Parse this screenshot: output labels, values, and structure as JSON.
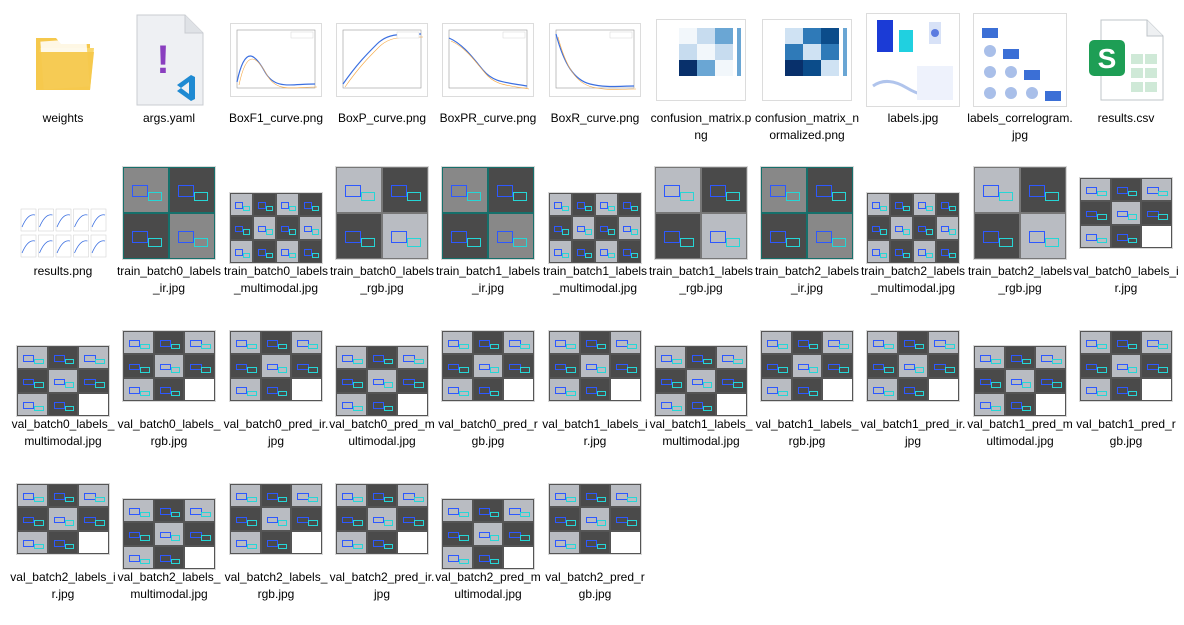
{
  "files": [
    {
      "name": "weights",
      "type": "folder"
    },
    {
      "name": "args.yaml",
      "type": "yaml"
    },
    {
      "name": "BoxF1_curve.png",
      "type": "curve"
    },
    {
      "name": "BoxP_curve.png",
      "type": "curve"
    },
    {
      "name": "BoxPR_curve.png",
      "type": "curve"
    },
    {
      "name": "BoxR_curve.png",
      "type": "curve"
    },
    {
      "name": "confusion_matrix.png",
      "type": "matrix"
    },
    {
      "name": "confusion_matrix_normalized.png",
      "type": "matrix"
    },
    {
      "name": "labels.jpg",
      "type": "labels"
    },
    {
      "name": "labels_correlogram.jpg",
      "type": "correlogram"
    },
    {
      "name": "results.csv",
      "type": "csv"
    },
    {
      "name": "results.png",
      "type": "results"
    },
    {
      "name": "train_batch0_labels_ir.jpg",
      "type": "train-ir"
    },
    {
      "name": "train_batch0_labels_multimodal.jpg",
      "type": "multimodal"
    },
    {
      "name": "train_batch0_labels_rgb.jpg",
      "type": "train-rgb"
    },
    {
      "name": "train_batch1_labels_ir.jpg",
      "type": "train-ir"
    },
    {
      "name": "train_batch1_labels_multimodal.jpg",
      "type": "multimodal"
    },
    {
      "name": "train_batch1_labels_rgb.jpg",
      "type": "train-rgb"
    },
    {
      "name": "train_batch2_labels_ir.jpg",
      "type": "train-ir"
    },
    {
      "name": "train_batch2_labels_multimodal.jpg",
      "type": "multimodal"
    },
    {
      "name": "train_batch2_labels_rgb.jpg",
      "type": "train-rgb"
    },
    {
      "name": "val_batch0_labels_ir.jpg",
      "type": "val"
    },
    {
      "name": "val_batch0_labels_multimodal.jpg",
      "type": "val-multi"
    },
    {
      "name": "val_batch0_labels_rgb.jpg",
      "type": "val"
    },
    {
      "name": "val_batch0_pred_ir.jpg",
      "type": "val"
    },
    {
      "name": "val_batch0_pred_multimodal.jpg",
      "type": "val-multi"
    },
    {
      "name": "val_batch0_pred_rgb.jpg",
      "type": "val"
    },
    {
      "name": "val_batch1_labels_ir.jpg",
      "type": "val"
    },
    {
      "name": "val_batch1_labels_multimodal.jpg",
      "type": "val-multi"
    },
    {
      "name": "val_batch1_labels_rgb.jpg",
      "type": "val"
    },
    {
      "name": "val_batch1_pred_ir.jpg",
      "type": "val"
    },
    {
      "name": "val_batch1_pred_multimodal.jpg",
      "type": "val-multi"
    },
    {
      "name": "val_batch1_pred_rgb.jpg",
      "type": "val"
    },
    {
      "name": "val_batch2_labels_ir.jpg",
      "type": "val"
    },
    {
      "name": "val_batch2_labels_multimodal.jpg",
      "type": "val-multi"
    },
    {
      "name": "val_batch2_labels_rgb.jpg",
      "type": "val"
    },
    {
      "name": "val_batch2_pred_ir.jpg",
      "type": "val"
    },
    {
      "name": "val_batch2_pred_multimodal.jpg",
      "type": "val-multi"
    },
    {
      "name": "val_batch2_pred_rgb.jpg",
      "type": "val"
    }
  ],
  "icons": {
    "folder_color": "#f5c84c",
    "yaml_mark": "!",
    "yaml_mark_color": "#8a3fbf",
    "vscode_color": "#1f8ad2",
    "csv_letter": "S",
    "csv_color": "#1e9e55"
  }
}
